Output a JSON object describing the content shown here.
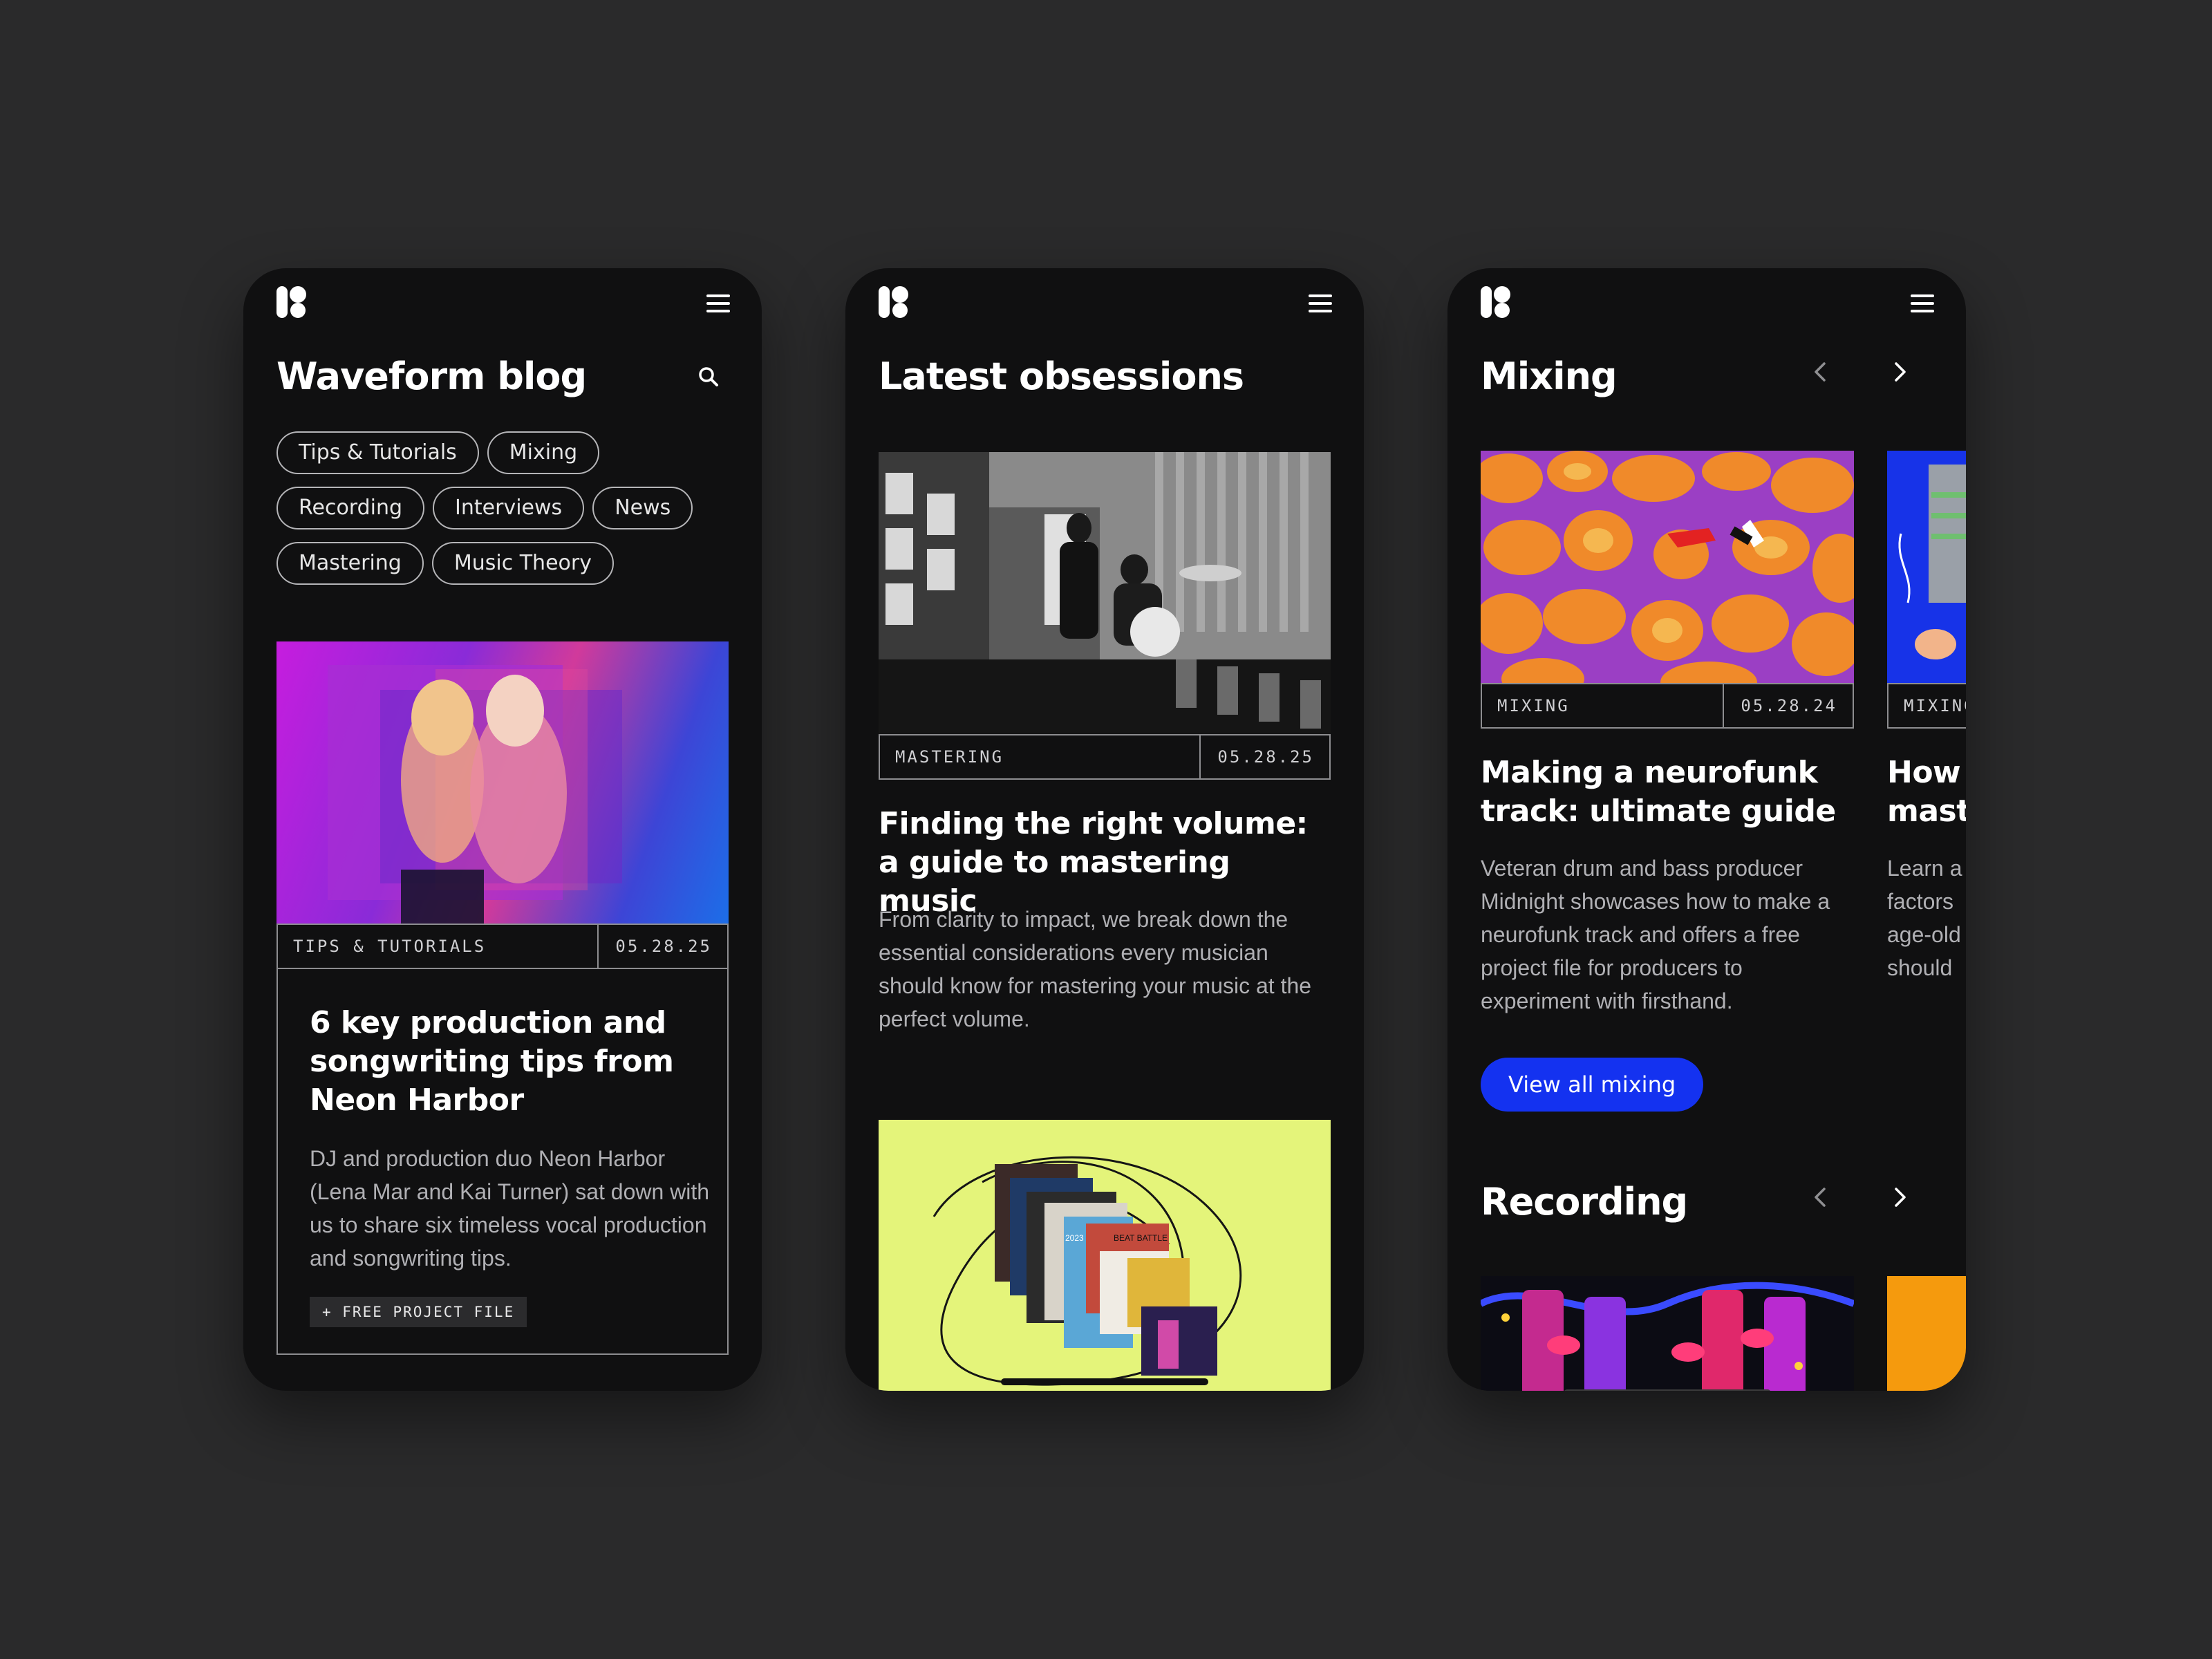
{
  "phone1": {
    "title": "Waveform blog",
    "chips": [
      "Tips & Tutorials",
      "Mixing",
      "Recording",
      "Interviews",
      "News",
      "Mastering",
      "Music Theory"
    ],
    "article": {
      "category": "TIPS & TUTORIALS",
      "date": "05.28.25",
      "title": "6 key production and songwriting tips from Neon Harbor",
      "excerpt": "DJ and production duo Neon Harbor (Lena Mar and Kai Turner) sat down with us to share six timeless vocal production and songwriting tips.",
      "tag": "+ FREE PROJECT FILE"
    }
  },
  "phone2": {
    "title": "Latest obsessions",
    "article": {
      "category": "MASTERING",
      "date": "05.28.25",
      "title": "Finding the right volume: a guide to mastering music",
      "excerpt": "From clarity to impact, we break down the essential considerations every musician should know for mastering your music at the perfect volume."
    },
    "collage": {
      "year_label": "2023",
      "poster_label": "BEAT BATTLE"
    }
  },
  "phone3": {
    "mixing": {
      "title": "Mixing",
      "card1": {
        "category": "MIXING",
        "date": "05.28.24",
        "title": "Making a neurofunk track: ultimate guide",
        "excerpt": "Veteran drum and bass producer Midnight showcases how to make a neurofunk track and offers a free project file for producers to experiment with firsthand."
      },
      "card2": {
        "category": "MIXING",
        "title": "How mast",
        "excerpt": "Learn a factors age-old should"
      },
      "view_all": "View all mixing"
    },
    "recording": {
      "title": "Recording"
    }
  },
  "colors": {
    "background": "#2a2a2b",
    "phone": "#101011",
    "accent_blue": "#1432f0",
    "collage_bg": "#e4f47a"
  },
  "icons": [
    "logo-icon",
    "menu-icon",
    "search-icon",
    "chevron-left-icon",
    "chevron-right-icon"
  ]
}
